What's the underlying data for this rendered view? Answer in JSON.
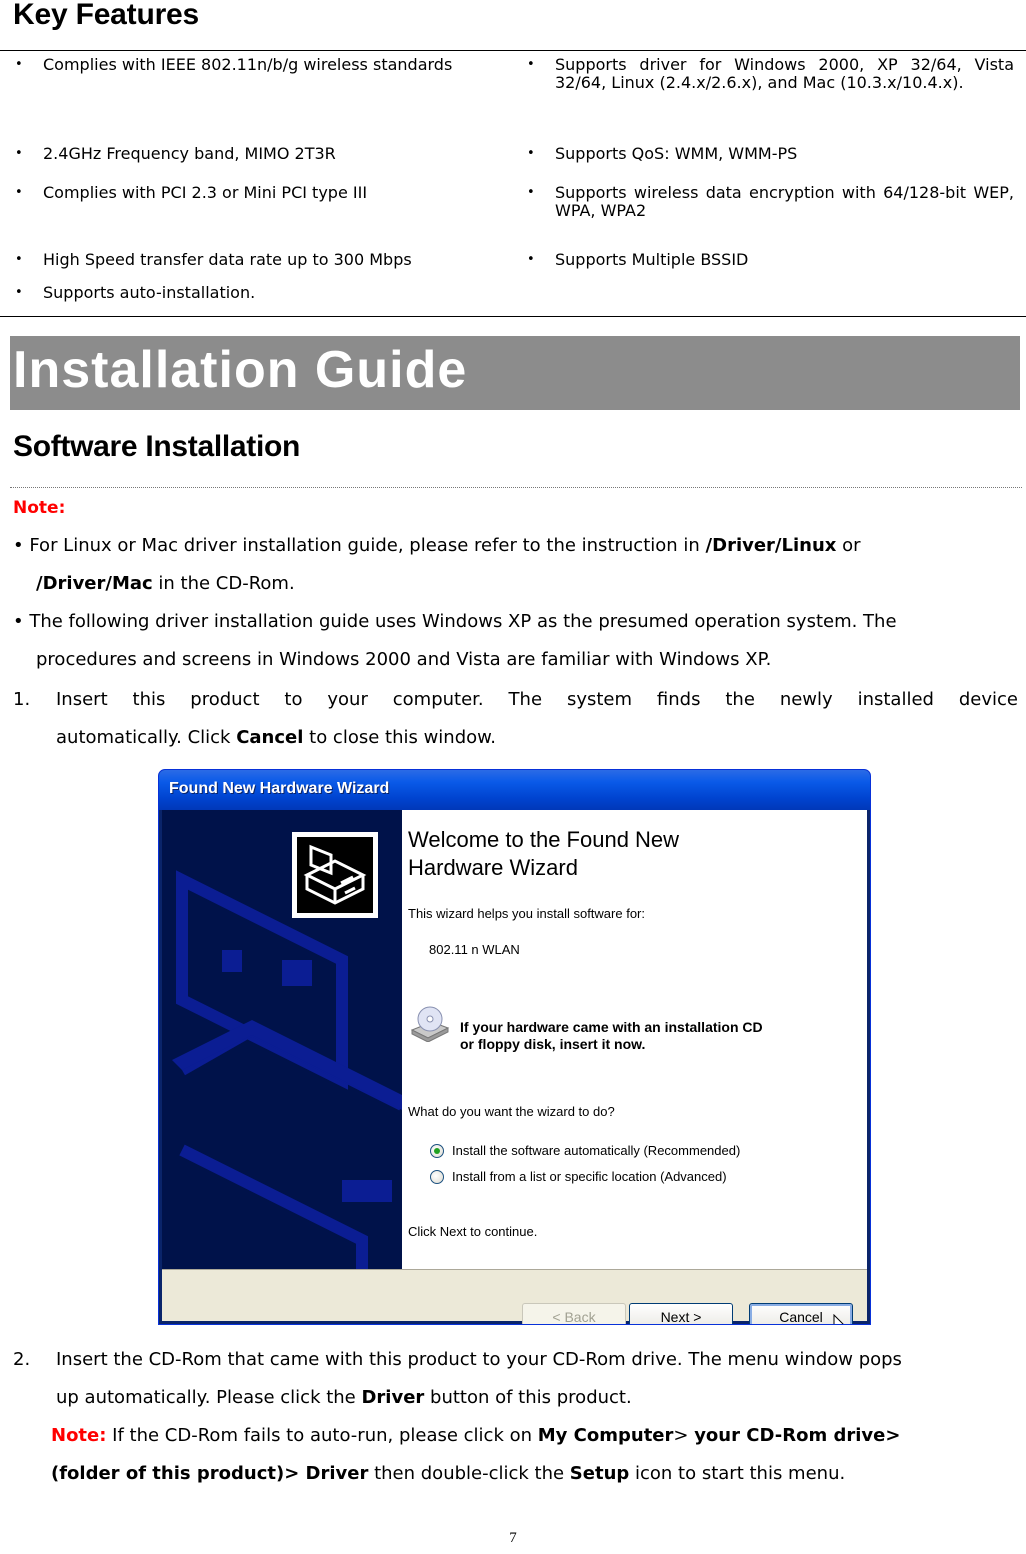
{
  "key_features": {
    "heading": "Key Features",
    "left": [
      "Complies with IEEE 802.11n/b/g wireless standards",
      "2.4GHz Frequency band, MIMO 2T3R",
      "Complies with PCI 2.3 or Mini PCI type III",
      "High Speed transfer data rate up to 300 Mbps",
      "Supports auto-installation."
    ],
    "right": [
      "Supports driver for Windows 2000, XP 32/64, Vista 32/64, Linux (2.4.x/2.6.x), and Mac (10.3.x/10.4.x).",
      "Supports QoS: WMM, WMM-PS",
      "Supports wireless data encryption with 64/128-bit WEP, WPA, WPA2",
      "Supports Multiple BSSID"
    ],
    "bullet": "•"
  },
  "banner": {
    "title": "Installation Guide",
    "color": "#8c8c8c"
  },
  "software": {
    "heading": "Software Installation",
    "note_label": "Note:",
    "note1": {
      "pre": "• For Linux or Mac driver installation guide, please refer to the instruction in ",
      "b1": "/Driver/Linux",
      "mid": " or",
      "b2": "/Driver/Mac",
      "post": " in the CD-Rom."
    },
    "note2": {
      "line1": "• The following driver installation guide uses Windows XP as the presumed operation system. The",
      "line2": "procedures and screens in Windows 2000 and Vista are familiar with Windows XP."
    },
    "step1": {
      "num": "1.",
      "line1": "Insert this product to your computer. The system finds the newly installed device",
      "pre": "automatically. Click ",
      "bold": "Cancel",
      "post": " to close this window."
    },
    "step2": {
      "num": "2.",
      "line1": "Insert the CD-Rom that came with this product to your CD-Rom drive. The menu window pops",
      "pre": "up automatically. Please click the ",
      "bold": "Driver",
      "post": " button of this product.",
      "note_label": "Note:",
      "note_pre": " If the CD-Rom fails to auto-run, please click on ",
      "note_b1": "My Computer",
      "note_gt": "> ",
      "note_b2": "your CD-Rom drive>",
      "note_b3": "(folder of this product)> Driver",
      "note_mid": " then double-click the ",
      "note_b4": "Setup",
      "note_post": " icon to start this menu."
    }
  },
  "wizard": {
    "title": "Found New Hardware Wizard",
    "heading_line1": "Welcome to the Found New",
    "heading_line2": "Hardware Wizard",
    "helps": "This wizard helps you install software for:",
    "device": "802.11 n WLAN",
    "cd_line1": "If your hardware came with an installation CD",
    "cd_line2": "or floppy disk, insert it now.",
    "question": "What do you want the wizard to do?",
    "options": [
      {
        "label": "Install the software automatically (Recommended)",
        "selected": true
      },
      {
        "label": "Install from a list or specific location (Advanced)",
        "selected": false
      }
    ],
    "continue": "Click Next to continue.",
    "buttons": {
      "back": "< Back",
      "next": "Next >",
      "cancel": "Cancel"
    }
  },
  "page_number": "7"
}
